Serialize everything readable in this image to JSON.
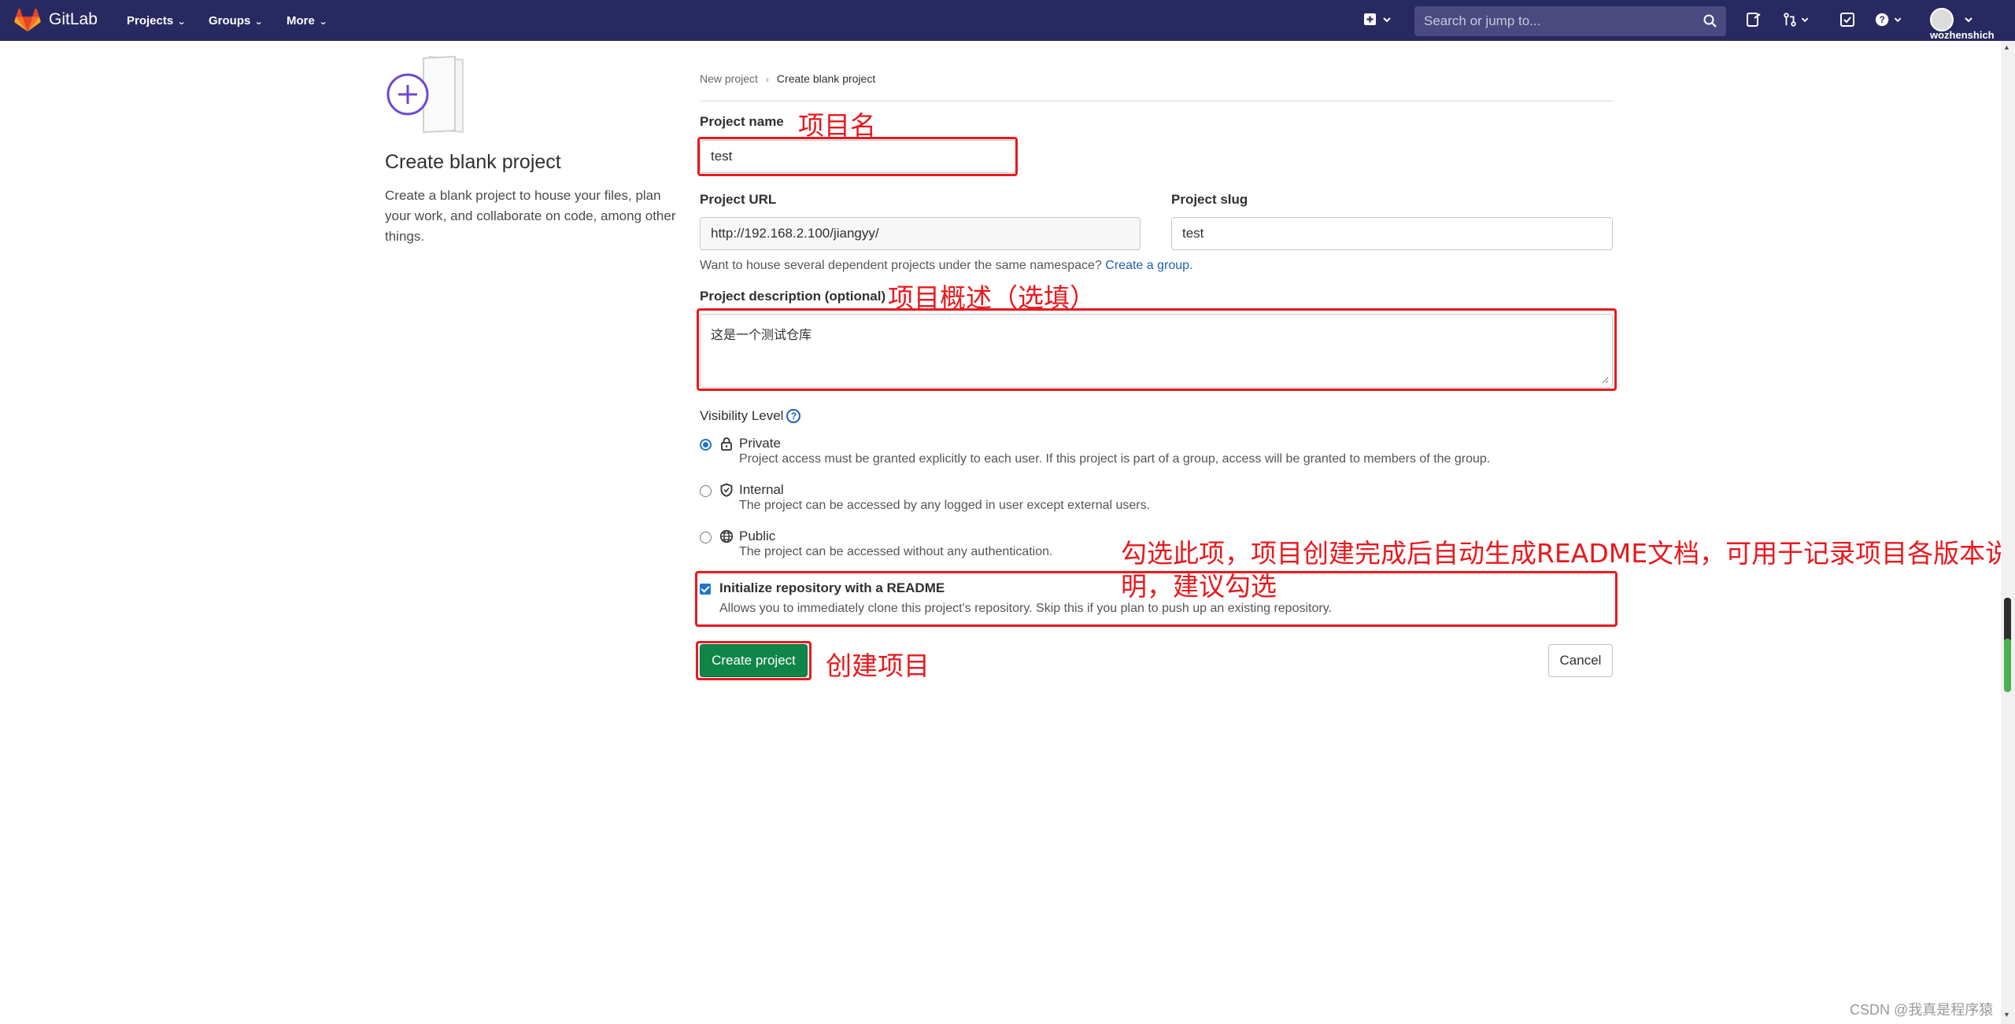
{
  "navbar": {
    "brand": "GitLab",
    "items": [
      {
        "label": "Projects"
      },
      {
        "label": "Groups"
      },
      {
        "label": "More"
      }
    ],
    "search_placeholder": "Search or jump to...",
    "username": "wozhenshich"
  },
  "sidebar": {
    "title": "Create blank project",
    "description": "Create a blank project to house your files, plan your work, and collaborate on code, among other things."
  },
  "breadcrumb": {
    "parent": "New project",
    "current": "Create blank project"
  },
  "form": {
    "project_name_label": "Project name",
    "project_name_value": "test",
    "project_url_label": "Project URL",
    "project_url_value": "http://192.168.2.100/jiangyy/",
    "project_slug_label": "Project slug",
    "project_slug_value": "test",
    "namespace_hint": "Want to house several dependent projects under the same namespace?",
    "namespace_link": "Create a group.",
    "description_label": "Project description (optional)",
    "description_value": "这是一个测试仓库",
    "visibility_label": "Visibility Level",
    "visibility_help": "?",
    "visibility_options": [
      {
        "title": "Private",
        "desc": "Project access must be granted explicitly to each user. If this project is part of a group, access will be granted to members of the group.",
        "checked": true
      },
      {
        "title": "Internal",
        "desc": "The project can be accessed by any logged in user except external users.",
        "checked": false
      },
      {
        "title": "Public",
        "desc": "The project can be accessed without any authentication.",
        "checked": false
      }
    ],
    "readme_title": "Initialize repository with a README",
    "readme_desc": "Allows you to immediately clone this project's repository. Skip this if you plan to push up an existing repository.",
    "readme_checked": true,
    "create_button": "Create project",
    "cancel_button": "Cancel"
  },
  "annotations": {
    "project_name": "项目名",
    "description": "项目概述（选填）",
    "readme_line1": "勾选此项，项目创建完成后自动生成README文档，可用于记录项目各版本说",
    "readme_line2": "明，建议勾选",
    "create": "创建项目"
  },
  "watermark": "CSDN @我真是程序猿",
  "colors": {
    "navbar": "#292961",
    "primary_button": "#108548",
    "link": "#1f5fb4",
    "annotation_red": "#e8191e"
  }
}
